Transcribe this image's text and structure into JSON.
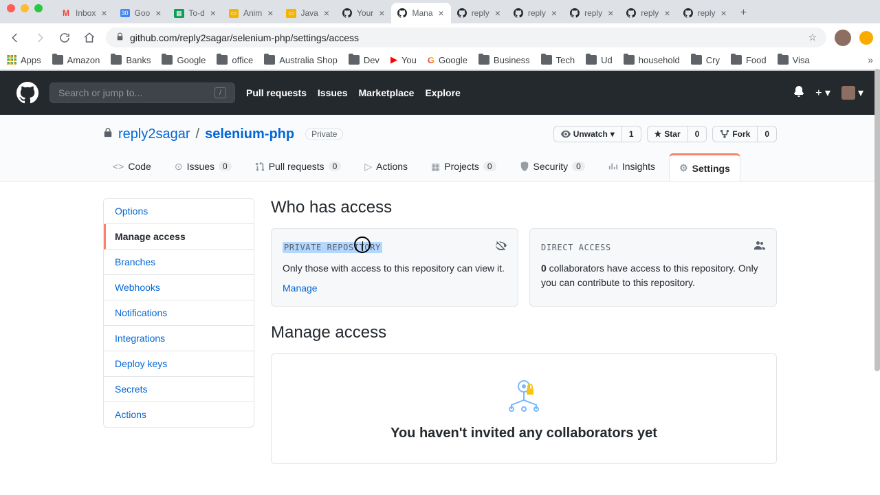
{
  "browser": {
    "tabs": [
      {
        "title": "Inbox",
        "fav": "gmail"
      },
      {
        "title": "Goo",
        "fav": "cal"
      },
      {
        "title": "To-d",
        "fav": "sheets"
      },
      {
        "title": "Anim",
        "fav": "slides"
      },
      {
        "title": "Java",
        "fav": "slides"
      },
      {
        "title": "Your",
        "fav": "gh"
      },
      {
        "title": "Mana",
        "fav": "gh",
        "active": true
      },
      {
        "title": "reply",
        "fav": "gh"
      },
      {
        "title": "reply",
        "fav": "gh"
      },
      {
        "title": "reply",
        "fav": "gh"
      },
      {
        "title": "reply",
        "fav": "gh"
      },
      {
        "title": "reply",
        "fav": "gh"
      }
    ],
    "url": "github.com/reply2sagar/selenium-php/settings/access",
    "bookmarks": [
      "Apps",
      "Amazon",
      "Banks",
      "Google",
      "office",
      "Australia Shop",
      "Dev",
      "You",
      "Google",
      "Business",
      "Tech",
      "Ud",
      "household",
      "Cry",
      "Food",
      "Visa"
    ]
  },
  "gh": {
    "search_placeholder": "Search or jump to...",
    "nav": {
      "pulls": "Pull requests",
      "issues": "Issues",
      "market": "Marketplace",
      "explore": "Explore"
    }
  },
  "repo": {
    "owner": "reply2sagar",
    "name": "selenium-php",
    "visibility": "Private",
    "watch": {
      "label": "Unwatch",
      "count": "1"
    },
    "star": {
      "label": "Star",
      "count": "0"
    },
    "fork": {
      "label": "Fork",
      "count": "0"
    },
    "tabs": {
      "code": "Code",
      "issues": "Issues",
      "issues_c": "0",
      "pulls": "Pull requests",
      "pulls_c": "0",
      "actions": "Actions",
      "projects": "Projects",
      "projects_c": "0",
      "security": "Security",
      "security_c": "0",
      "insights": "Insights",
      "settings": "Settings"
    }
  },
  "sidebar": {
    "items": [
      "Options",
      "Manage access",
      "Branches",
      "Webhooks",
      "Notifications",
      "Integrations",
      "Deploy keys",
      "Secrets",
      "Actions"
    ],
    "active_index": 1
  },
  "page": {
    "h_who": "Who has access",
    "card_private": {
      "title": "PRIVATE REPOSITORY",
      "body": "Only those with access to this repository can view it.",
      "link": "Manage"
    },
    "card_direct": {
      "title": "DIRECT ACCESS",
      "body_prefix": "0",
      "body": " collaborators have access to this repository. Only you can contribute to this repository."
    },
    "h_manage": "Manage access",
    "empty_h": "You haven't invited any collaborators yet"
  }
}
